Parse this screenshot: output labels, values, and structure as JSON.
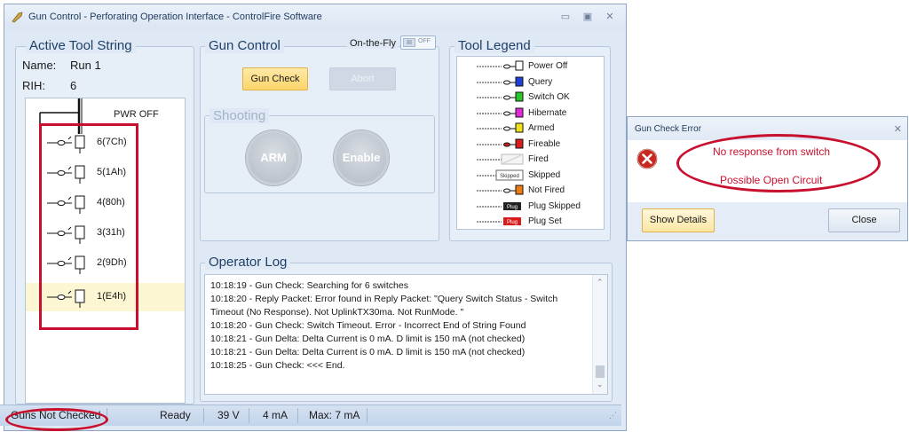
{
  "window": {
    "title": "Gun Control - Perforating Operation Interface - ControlFire Software",
    "controls": [
      "▭",
      "▣",
      "✕"
    ]
  },
  "tool_string": {
    "title": "Active Tool String",
    "name_label": "Name:",
    "name_value": "Run 1",
    "rih_label": "RIH:",
    "rih_value": "6",
    "power_label": "PWR OFF",
    "switches": [
      {
        "label": "6(7Ch)"
      },
      {
        "label": "5(1Ah)"
      },
      {
        "label": "4(80h)"
      },
      {
        "label": "3(31h)"
      },
      {
        "label": "2(9Dh)"
      },
      {
        "label": "1(E4h)"
      }
    ]
  },
  "gun_control": {
    "title": "Gun Control",
    "on_the_fly_label": "On-the-Fly",
    "toggle_knob": "III",
    "toggle_state": "OFF",
    "gun_check_label": "Gun Check",
    "abort_label": "Abort",
    "shooting_title": "Shooting",
    "arm_label": "ARM",
    "enable_label": "Enable"
  },
  "legend": {
    "title": "Tool Legend",
    "items": [
      {
        "label": "Power Off",
        "color": "#ffffff"
      },
      {
        "label": "Query",
        "color": "#1f3fd6"
      },
      {
        "label": "Switch OK",
        "color": "#28c828"
      },
      {
        "label": "Hibernate",
        "color": "#e02ad8"
      },
      {
        "label": "Armed",
        "color": "#f2e01c"
      },
      {
        "label": "Fireable",
        "color": "#d81c1c"
      },
      {
        "label": "Fired",
        "color": "#f4f4f4"
      },
      {
        "label": "Skipped",
        "color": "#ffffff",
        "tag": "Skipped"
      },
      {
        "label": "Not Fired",
        "color": "#f07a12"
      },
      {
        "label": "Plug Skipped",
        "color": "#222222",
        "tag": "Plug"
      },
      {
        "label": "Plug Set",
        "color": "#d81c1c",
        "tag": "Plug"
      }
    ]
  },
  "operator_log": {
    "title": "Operator Log",
    "lines": [
      "10:18:19 - Gun Check: Searching for 6 switches",
      "10:18:20 - Reply Packet: Error found in Reply Packet: \"Query Switch Status - Switch",
      "Timeout (No Response). Not UplinkTX30ma. Not RunMode. \"",
      "10:18:20 - Gun Check: Switch Timeout. Error - Incorrect End of String Found",
      "10:18:21 - Gun Delta: Delta Current is 0 mA. D limit is 150 mA (not checked)",
      "10:18:21 - Gun Delta: Delta Current is 0 mA. D limit is 150 mA (not checked)",
      "10:18:25 - Gun Check: <<< End."
    ]
  },
  "status_bar": {
    "guns_status": "Guns Not Checked",
    "ready": "Ready",
    "voltage": "39 V",
    "current": "4 mA",
    "max_current": "Max: 7 mA"
  },
  "dialog": {
    "title": "Gun Check Error",
    "close_x": "✕",
    "message_line1": "No response from switch",
    "message_line2": "Possible Open Circuit",
    "show_details_label": "Show Details",
    "close_label": "Close"
  },
  "colors": {
    "annotation_red": "#c8102e",
    "accent_blue": "#1e3f66",
    "selected_row": "#fdf6d3"
  }
}
